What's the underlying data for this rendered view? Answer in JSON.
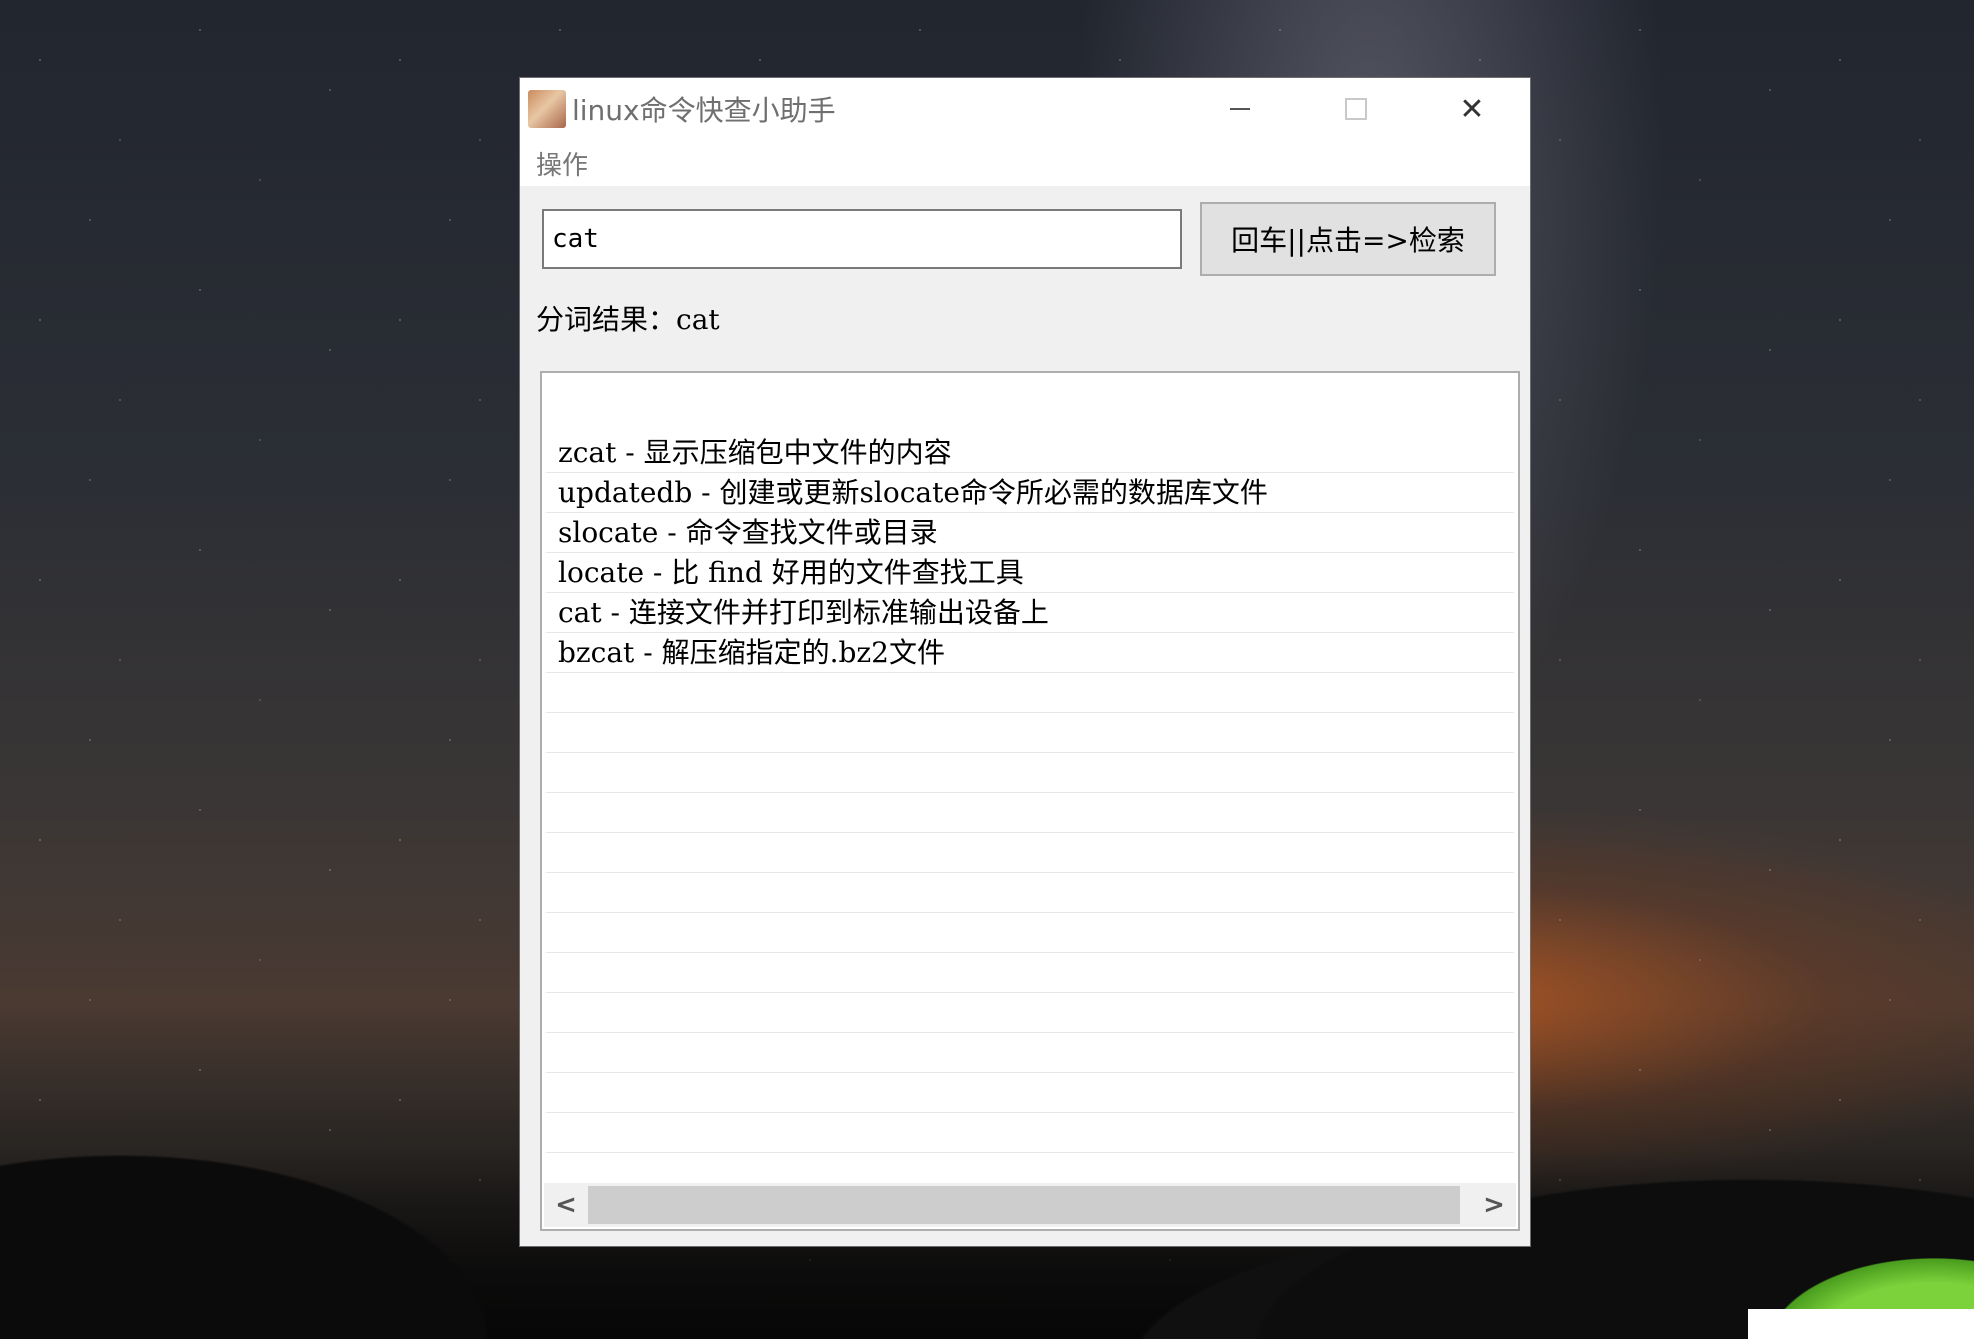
{
  "window": {
    "title": "linux命令快查小助手",
    "controls": {
      "minimize": "minimize",
      "maximize": "maximize",
      "close": "✕"
    }
  },
  "menu": {
    "items": [
      {
        "label": "操作"
      }
    ]
  },
  "search": {
    "value": "cat",
    "button_label": "回车||点击=>检索"
  },
  "segmentation": {
    "label": "分词结果：",
    "value": "cat"
  },
  "results": {
    "items": [
      "zcat - 显示压缩包中文件的内容",
      "updatedb - 创建或更新slocate命令所必需的数据库文件",
      "slocate - 命令查找文件或目录",
      "locate - 比 find 好用的文件查找工具",
      "cat - 连接文件并打印到标准输出设备上",
      "bzcat - 解压缩指定的.bz2文件"
    ]
  },
  "scrollbar": {
    "left_arrow": "<",
    "right_arrow": ">"
  },
  "icons": [
    "app-icon",
    "minimize-icon",
    "maximize-icon",
    "close-icon",
    "chevron-left-icon",
    "chevron-right-icon"
  ]
}
